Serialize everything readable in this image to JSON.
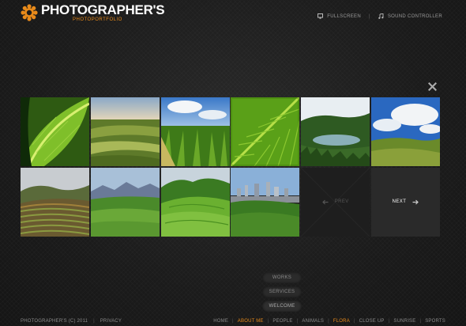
{
  "brand": {
    "title": "PHOTOGRAPHER'S",
    "subtitle": "PHOTOPORTFOLIO",
    "accent_color": "#e88a1a"
  },
  "top_controls": {
    "fullscreen_label": "FULLSCREEN",
    "sound_label": "SOUND CONTROLLER",
    "separator": "|"
  },
  "gallery": {
    "photos": [
      {
        "name": "leaf-closeup"
      },
      {
        "name": "rolling-fields"
      },
      {
        "name": "cornfield-sky"
      },
      {
        "name": "green-leaf"
      },
      {
        "name": "crater-lake"
      },
      {
        "name": "hills-clouds"
      },
      {
        "name": "terraced-valley"
      },
      {
        "name": "mountain-meadow"
      },
      {
        "name": "green-hills"
      },
      {
        "name": "city-hills"
      }
    ],
    "prev_label": "PREV",
    "next_label": "NEXT"
  },
  "bottom_menu": {
    "items": [
      "WORKS",
      "SERVICES",
      "WELCOME"
    ]
  },
  "footer": {
    "copyright": "PHOTOGRAPHER'S (C) 2011",
    "privacy": "PRIVACY",
    "nav": [
      "HOME",
      "ABOUT ME",
      "PEOPLE",
      "ANIMALS",
      "FLORA",
      "CLOSE UP",
      "SUNRISE",
      "SPORTS"
    ],
    "active_items": [
      "ABOUT ME",
      "FLORA"
    ]
  }
}
